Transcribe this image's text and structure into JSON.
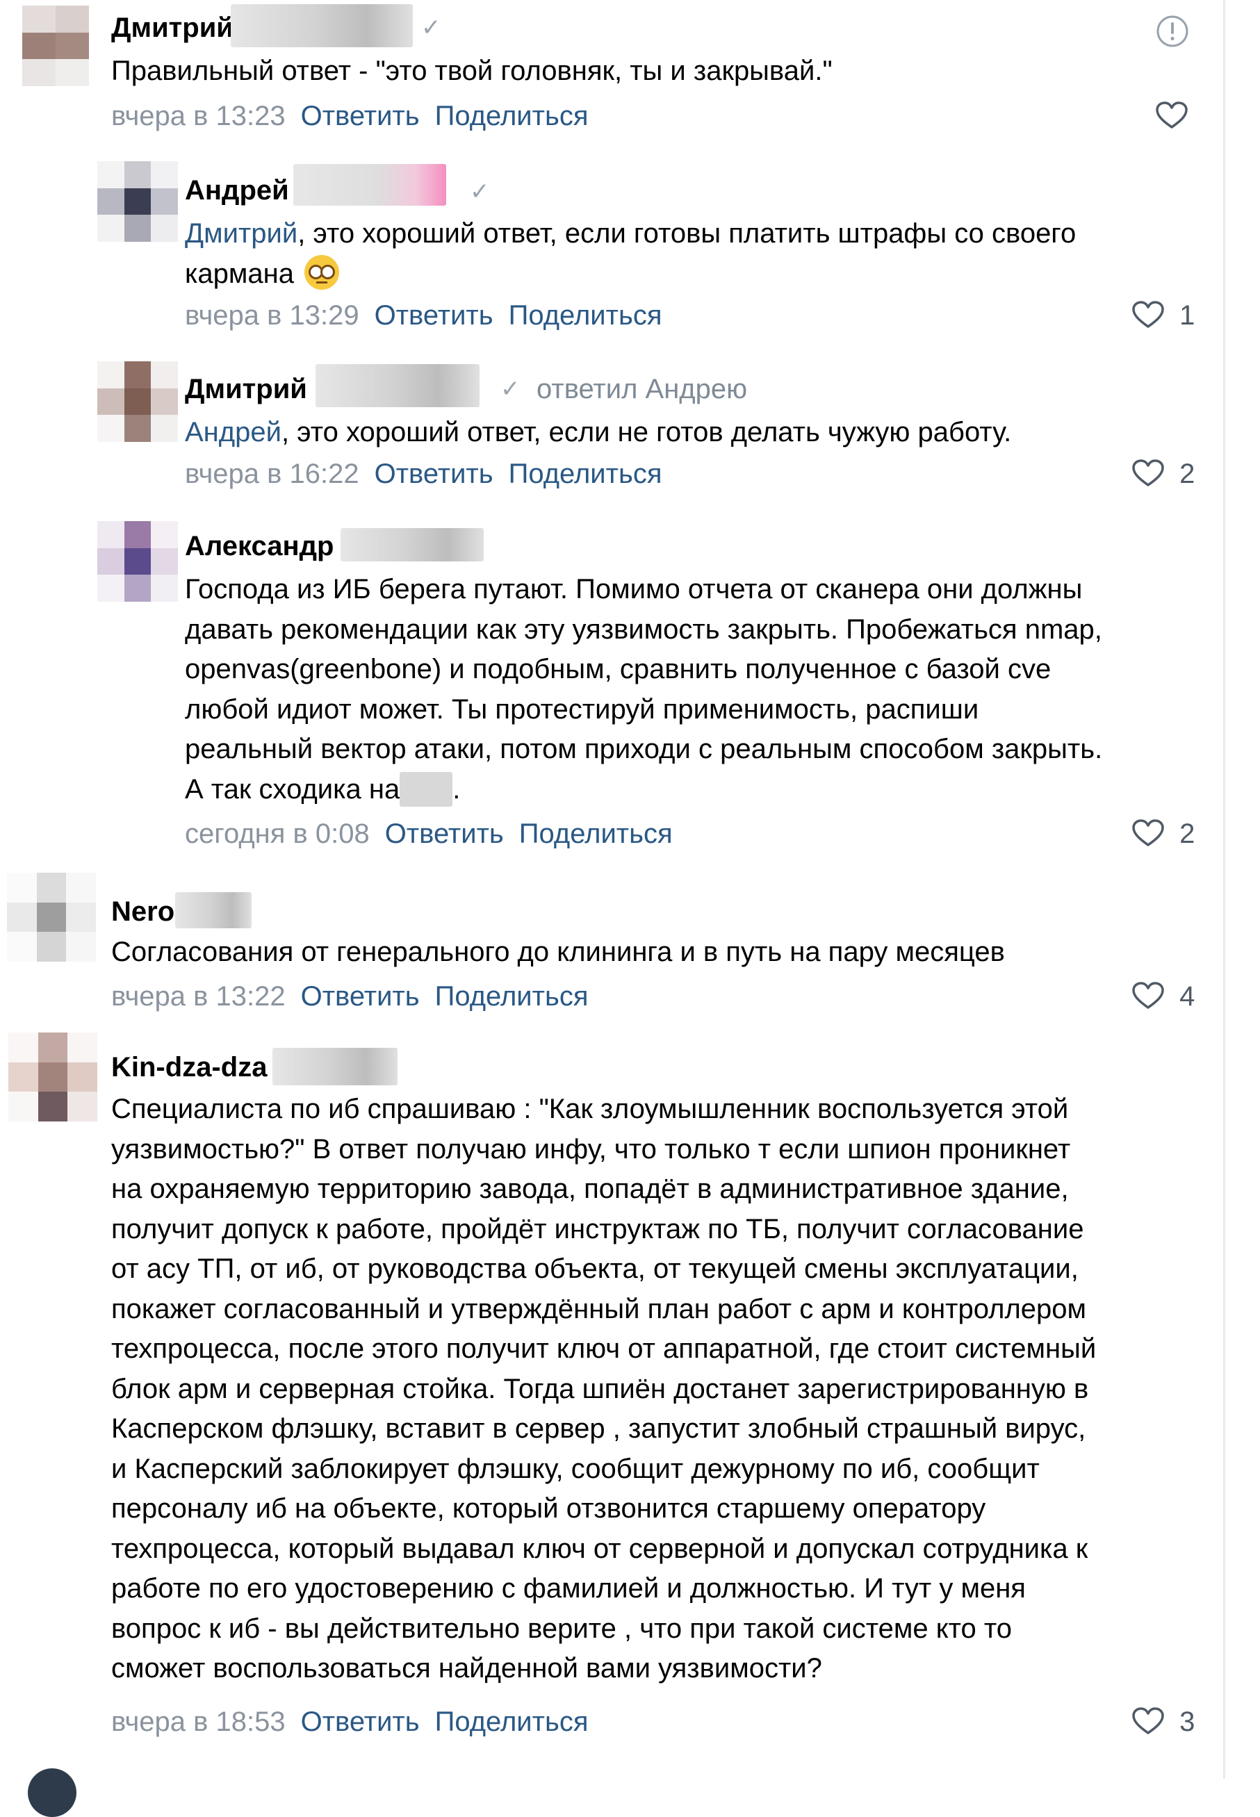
{
  "comments": [
    {
      "author": "Дмитрий",
      "text_lines": [
        "Правильный ответ - \"это твой головняк, ты и закрывай.\""
      ],
      "time": "вчера в 13:23",
      "reply_label": "Ответить",
      "share_label": "Поделиться",
      "likes": ""
    },
    {
      "author": "Андрей",
      "mention": "Дмитрий",
      "text_lines": [
        ", это хороший ответ, если готовы платить штрафы со своего",
        "кармана"
      ],
      "time": "вчера в 13:29",
      "reply_label": "Ответить",
      "share_label": "Поделиться",
      "likes": "1"
    },
    {
      "author": "Дмитрий",
      "replied_to": "ответил Андрею",
      "mention": "Андрей",
      "text_lines": [
        ", это хороший ответ, если не готов делать чужую работу."
      ],
      "time": "вчера в 16:22",
      "reply_label": "Ответить",
      "share_label": "Поделиться",
      "likes": "2"
    },
    {
      "author": "Александр",
      "text_lines": [
        "Господа из ИБ берега путают. Помимо отчета от сканера они должны",
        "давать рекомендации как эту уязвимость закрыть. Пробежаться nmap,",
        "openvas(greenbone) и подобным, сравнить полученное с базой cve",
        "любой идиот может. Ты протестируй применимость, распиши",
        "реальный вектор атаки, потом приходи с реальным способом закрыть.",
        "А так сходика на",
        "."
      ],
      "time": "сегодня в 0:08",
      "reply_label": "Ответить",
      "share_label": "Поделиться",
      "likes": "2"
    },
    {
      "author": "Nero",
      "text_lines": [
        "Согласования от генерального до клининга и в путь на пару месяцев"
      ],
      "time": "вчера в 13:22",
      "reply_label": "Ответить",
      "share_label": "Поделиться",
      "likes": "4"
    },
    {
      "author": "Kin-dza-dza",
      "text_lines": [
        "Специалиста по иб спрашиваю : \"Как злоумышленник воспользуется этой",
        "уязвимостью?\" В ответ получаю инфу, что только т если шпион проникнет",
        "на охраняемую территорию завода, попадёт в административное здание,",
        "получит допуск к работе, пройдёт инструктаж по ТБ, получит согласование",
        "от асу ТП, от иб, от руководства объекта, от текущей смены эксплуатации,",
        "покажет согласованный и утверждённый план работ с арм и контроллером",
        "техпроцесса, после этого получит ключ от аппаратной, где стоит системный",
        "блок арм и серверная стойка. Тогда шпиён достанет зарегистрированную в",
        "Касперском флэшку, вставит в сервер , запустит злобный страшный вирус,",
        "и Касперский заблокирует флэшку, сообщит дежурному по иб, сообщит",
        "персоналу иб на объекте, который отзвонится старшему оператору",
        "техпроцесса, который выдавал ключ от серверной и допускал сотрудника к",
        "работе по его удостоверению с фамилией и должностью. И тут у меня",
        "вопрос к иб - вы действительно верите , что при такой системе кто то",
        "сможет воспользоваться найденной вами уязвимости?"
      ],
      "time": "вчера в 18:53",
      "reply_label": "Ответить",
      "share_label": "Поделиться",
      "likes": "3"
    }
  ],
  "icons": {
    "report": "exclamation-circle-icon",
    "like": "heart-outline-icon",
    "verified": "checkmark-icon"
  },
  "colors": {
    "link": "#2a5885",
    "time": "#8a939e",
    "text": "#000000",
    "icon": "#505a66"
  }
}
